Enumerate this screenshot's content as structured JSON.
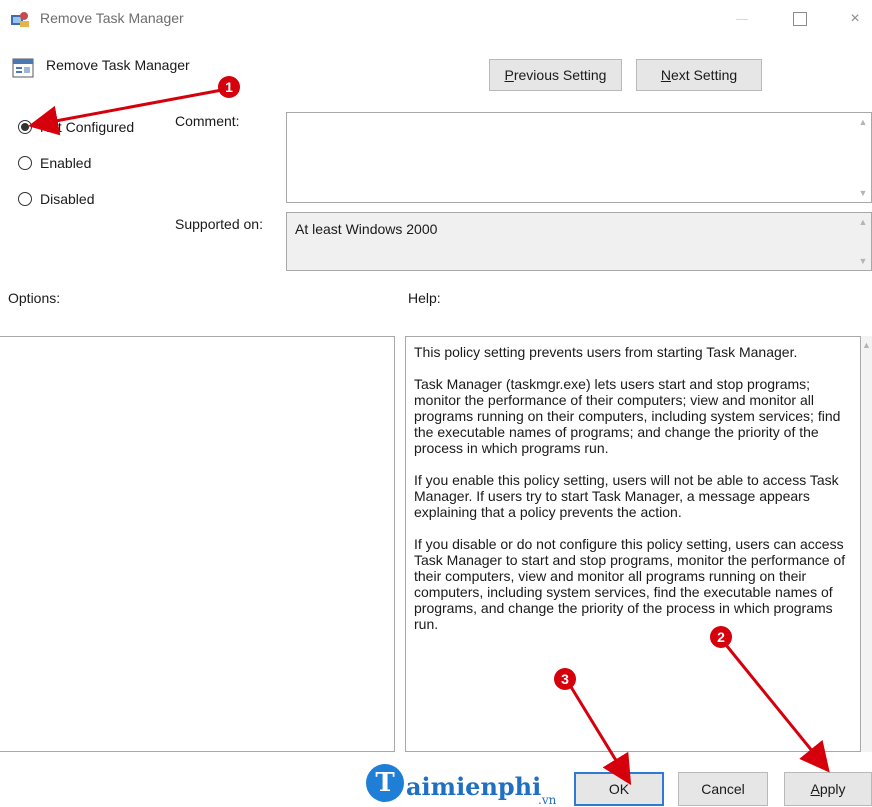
{
  "window": {
    "title": "Remove Task Manager",
    "controls": {
      "minimize": "—",
      "maximize": "",
      "close": "×"
    }
  },
  "header": {
    "policy_name": "Remove Task Manager",
    "previous_setting": "Previous Setting",
    "next_setting": "Next Setting"
  },
  "state": {
    "options": [
      {
        "label": "Not Configured",
        "checked": true
      },
      {
        "label": "Enabled",
        "checked": false
      },
      {
        "label": "Disabled",
        "checked": false
      }
    ]
  },
  "comment": {
    "label": "Comment:",
    "value": ""
  },
  "supported": {
    "label": "Supported on:",
    "value": "At least Windows 2000"
  },
  "options_label": "Options:",
  "help": {
    "label": "Help:",
    "paragraphs": [
      "This policy setting prevents users from starting Task Manager.",
      "Task Manager (taskmgr.exe) lets users start and stop programs; monitor the performance of their computers; view and monitor all programs running on their computers, including system services; find the executable names of programs; and change the priority of the process in which programs run.",
      "If you enable this policy setting, users will not be able to access Task Manager. If users try to start Task Manager, a message appears explaining that a policy prevents the action.",
      "If you disable or do not configure this policy setting, users can access Task Manager to  start and stop programs, monitor the performance of their computers, view and monitor all programs running on their computers, including system services, find the executable names of programs, and change the priority of the process in which programs run."
    ]
  },
  "footer": {
    "ok": "OK",
    "cancel": "Cancel",
    "apply": "Apply"
  },
  "annotations": {
    "badges": [
      "1",
      "2",
      "3"
    ],
    "color": "#d6000c"
  },
  "watermark": {
    "letter": "T",
    "text": "aimienphi",
    "sub": ".vn"
  }
}
